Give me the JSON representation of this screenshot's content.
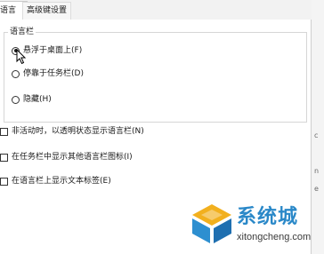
{
  "tabs": [
    {
      "label": "语言栏",
      "selected": true
    },
    {
      "label": "高级键设置",
      "selected": false
    }
  ],
  "language_bar": {
    "group_title": "语言栏",
    "options": [
      {
        "label": "悬浮于桌面上(F)",
        "checked": true
      },
      {
        "label": "停靠于任务栏(D)",
        "checked": false
      },
      {
        "label": "隐藏(H)",
        "checked": false
      }
    ]
  },
  "checkboxes": [
    {
      "label": "非活动时，以透明状态显示语言栏(N)",
      "checked": false
    },
    {
      "label": "在任务栏中显示其他语言栏图标(I)",
      "checked": false
    },
    {
      "label": "在语言栏上显示文本标签(E)",
      "checked": false
    }
  ],
  "right_edge_marks": [
    "",
    "c",
    "n",
    "e"
  ],
  "watermark": {
    "text": "系统城",
    "url": "xitongcheng.com"
  }
}
